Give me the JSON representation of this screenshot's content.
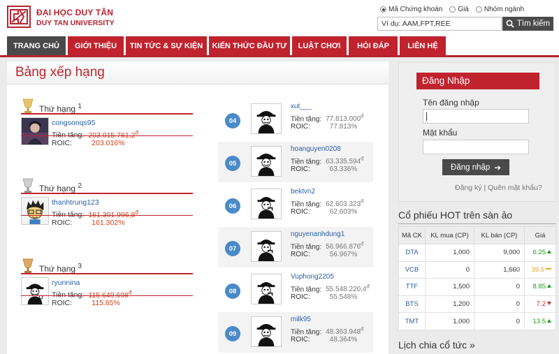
{
  "header": {
    "title": "ĐẠI HỌC DUY TÂN",
    "subtitle": "DUY TAN UNIVERSITY"
  },
  "search": {
    "options": [
      "Mã Chứng khoán",
      "Giá",
      "Nhóm ngành"
    ],
    "selected": "Mã Chứng khoán",
    "value": "Ví dụ: AAM,FPT,REE",
    "button": "Tìm kiếm"
  },
  "nav": [
    {
      "label": "TRANG CHỦ",
      "active": true
    },
    {
      "label": "GIỚI THIỆU"
    },
    {
      "label": "TIN TỨC & SỰ KIỆN"
    },
    {
      "label": "KIẾN THỨC ĐẦU TƯ"
    },
    {
      "label": "LUẬT CHƠI"
    },
    {
      "label": "HỎI ĐÁP"
    },
    {
      "label": "LIÊN HỆ"
    }
  ],
  "leaderboard": {
    "title": "Bảng xếp hạng",
    "rank_label": "Thứ hạng",
    "money_label": "Tiền tăng:",
    "roic_label": "ROIC:",
    "currency": "đ",
    "top": [
      {
        "rank": "1",
        "user": "congsonqs95",
        "money": "203.015.761,2",
        "roic": "203.016%"
      },
      {
        "rank": "2",
        "user": "thanhtrung123",
        "money": "161.301.996,8",
        "roic": "161.302%"
      },
      {
        "rank": "3",
        "user": "ryunnina",
        "money": "115.649.698",
        "roic": "115.65%"
      }
    ],
    "list": [
      {
        "rank": "04",
        "user": "xut___",
        "money": "77.813.000",
        "roic": "77.813%"
      },
      {
        "rank": "05",
        "user": "hoanguyen0208",
        "money": "63.335.594",
        "roic": "63.336%"
      },
      {
        "rank": "06",
        "user": "bektvn2",
        "money": "62.603.323",
        "roic": "62.603%"
      },
      {
        "rank": "07",
        "user": "nguyenanhdung1",
        "money": "56.966.876",
        "roic": "56.967%"
      },
      {
        "rank": "08",
        "user": "Vuphong2205",
        "money": "55.548.220,4",
        "roic": "55.548%"
      },
      {
        "rank": "09",
        "user": "milk95",
        "money": "48.363.948",
        "roic": "48.364%"
      }
    ]
  },
  "login": {
    "title": "Đăng Nhập",
    "username_label": "Tên đăng nhập",
    "password_label": "Mật khẩu",
    "button": "Đăng nhập",
    "register": "Đăng ký",
    "separator": "|",
    "forgot": "Quên mật khẩu?"
  },
  "hot_stocks": {
    "title": "Cổ phiếu HOT trên sàn ảo",
    "headers": [
      "Mã CK",
      "KL mua (CP)",
      "KL bán (CP)",
      "Giá"
    ],
    "rows": [
      {
        "code": "DTA",
        "buy": "1,000",
        "sell": "9,000",
        "price": "6.25",
        "trend": "up",
        "color": "#1a9c1a"
      },
      {
        "code": "VCB",
        "buy": "0",
        "sell": "1,660",
        "price": "39.5",
        "trend": "flat",
        "color": "#e8a317"
      },
      {
        "code": "TTF",
        "buy": "1,500",
        "sell": "0",
        "price": "8.85",
        "trend": "up",
        "color": "#1a9c1a"
      },
      {
        "code": "BTS",
        "buy": "1,200",
        "sell": "0",
        "price": "7.2",
        "trend": "down",
        "color": "#d0281a"
      },
      {
        "code": "TMT",
        "buy": "1,000",
        "sell": "0",
        "price": "13.5",
        "trend": "up",
        "color": "#1a9c1a"
      }
    ]
  },
  "dividend": {
    "title": "Lịch chia cổ tức »"
  }
}
